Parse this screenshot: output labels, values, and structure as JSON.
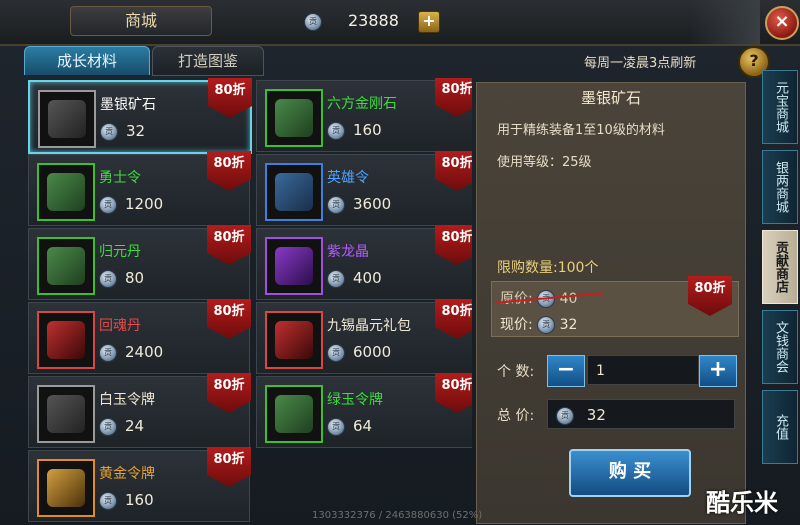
{
  "header": {
    "title": "商城",
    "currency_value": "23888",
    "add_label": "+",
    "close_label": "×"
  },
  "tabs": [
    {
      "label": "成长材料",
      "active": true
    },
    {
      "label": "打造图鉴",
      "active": false
    }
  ],
  "refresh_note": "每周一凌晨3点刷新",
  "help_label": "?",
  "items": [
    {
      "name": "墨银矿石",
      "price": "32",
      "badge": "80折",
      "name_color": "#ffffff",
      "rarity": "white",
      "icon": "ore-icon"
    },
    {
      "name": "六方金刚石",
      "price": "160",
      "badge": "80折",
      "name_color": "#3fdc3f",
      "rarity": "green",
      "icon": "crystal-icon"
    },
    {
      "name": "勇士令",
      "price": "1200",
      "badge": "80折",
      "name_color": "#3fdc3f",
      "rarity": "green",
      "icon": "token-icon"
    },
    {
      "name": "英雄令",
      "price": "3600",
      "badge": "80折",
      "name_color": "#4ea3ff",
      "rarity": "blue",
      "icon": "token-icon"
    },
    {
      "name": "归元丹",
      "price": "80",
      "badge": "80折",
      "name_color": "#3fdc3f",
      "rarity": "green",
      "icon": "pill-icon"
    },
    {
      "name": "紫龙晶",
      "price": "400",
      "badge": "80折",
      "name_color": "#b55cff",
      "rarity": "purple",
      "icon": "gem-icon"
    },
    {
      "name": "回魂丹",
      "price": "2400",
      "badge": "80折",
      "name_color": "#e84848",
      "rarity": "red",
      "icon": "orb-icon"
    },
    {
      "name": "九锡晶元礼包",
      "price": "6000",
      "badge": "80折",
      "name_color": "#f0e8d0",
      "rarity": "red",
      "icon": "bag-icon"
    },
    {
      "name": "白玉令牌",
      "price": "24",
      "badge": "80折",
      "name_color": "#f0e8d0",
      "rarity": "white",
      "icon": "tablet-icon"
    },
    {
      "name": "绿玉令牌",
      "price": "64",
      "badge": "80折",
      "name_color": "#3fdc3f",
      "rarity": "green",
      "icon": "tablet-icon"
    },
    {
      "name": "黄金令牌",
      "price": "160",
      "badge": "80折",
      "name_color": "#e8a030",
      "rarity": "orange",
      "icon": "tablet-icon"
    }
  ],
  "detail": {
    "title": "墨银矿石",
    "description": "用于精练装备1至10级的材料",
    "level": "使用等级：25级",
    "limit": "限购数量:100个",
    "original_label": "原价:",
    "original_value": "40",
    "now_label": "现价:",
    "now_value": "32",
    "badge": "80折",
    "qty_label": "个 数:",
    "qty_value": "1",
    "total_label": "总 价:",
    "total_value": "32",
    "buy_label": "购 买"
  },
  "side_tabs": [
    {
      "label": "元宝商城",
      "active": false
    },
    {
      "label": "银两商城",
      "active": false
    },
    {
      "label": "贡献商店",
      "active": true
    },
    {
      "label": "文钱商会",
      "active": false
    },
    {
      "label": "充值",
      "active": false
    }
  ],
  "watermark": "酷乐米",
  "footer_id": "1303332376 / 2463880630 (52%)"
}
